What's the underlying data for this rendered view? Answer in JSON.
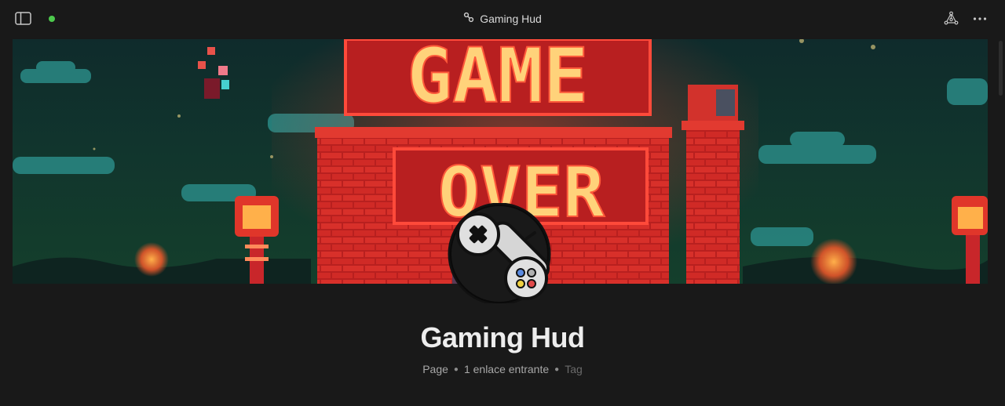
{
  "window": {
    "title": "Gaming Hud",
    "sync_status_color": "#4cc94c"
  },
  "icons": {
    "sidebar": "sidebar-toggle-icon",
    "title": "link-chain-icon",
    "graph": "graph-view-icon",
    "more": "more-options-icon",
    "page": "game-controller-icon"
  },
  "banner": {
    "description_icon": "pixel-art-banner",
    "sign_top_text": "GAME",
    "sign_bottom_text": "OVER"
  },
  "page": {
    "title": "Gaming Hud",
    "meta": {
      "type": "Page",
      "backlinks": "1 enlace entrante",
      "tag_placeholder": "Tag"
    }
  },
  "colors": {
    "background": "#191919",
    "neon_red": "#e8262b",
    "neon_glow": "#ffd27a"
  }
}
